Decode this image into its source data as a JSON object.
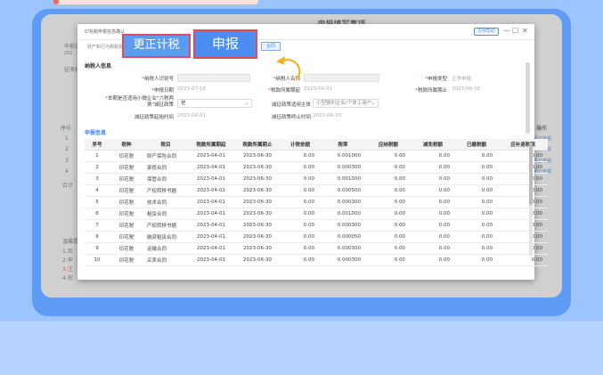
{
  "background": {
    "page_title": "申报填写事项",
    "side_labels": [
      "申报日",
      "202",
      "征收标",
      "序号",
      "1",
      "2",
      "3",
      "4",
      "合计",
      "温馨提",
      "1.到",
      "2.申",
      "3.注",
      "4.创"
    ],
    "ops_header": "操作",
    "ops_links": [
      "更正申报",
      "更正申报",
      "更正申报",
      "更正申报"
    ]
  },
  "dialog": {
    "title": "印花税申报信息确认",
    "subtitle": "财产和行为税税源",
    "help_label": "在线帮助",
    "controls": [
      "—",
      "☐",
      "✕"
    ],
    "ht_button": "合同",
    "taxpayer_section": "纳税人信息",
    "fields": {
      "taxpayer_id_label": "纳税人识别号",
      "taxpayer_name_label": "纳税人名称",
      "declare_type_label": "申报类型",
      "declare_type_value": "正常申报",
      "declare_date_label": "申报日期",
      "declare_date_value": "2023-07-18",
      "period_start_label": "税款所属期起",
      "period_start_value": "2023-04-01",
      "period_end_label": "税款所属期止",
      "period_end_value": "2023-06-30",
      "policy_label_1": "本期是否适用小微企业\"六税两",
      "policy_label_2": "费\"减征政策",
      "policy_value": "是",
      "subject_label": "减征政策适用主体",
      "subject_value": "小型微利企业/个体工商户",
      "reduce_start_label": "减征政策起始时间",
      "reduce_start_value": "2023-04-01",
      "reduce_end_label": "减征政策终止时间",
      "reduce_end_value": "2023-06-30"
    },
    "table_section": "申报信息",
    "columns": [
      "序号",
      "税种",
      "税目",
      "税款所属期起",
      "税款所属期止",
      "计税依据",
      "税率",
      "应纳税额",
      "减免税额",
      "已缴税额",
      "应补退税额"
    ],
    "rows": [
      [
        "1",
        "印花税",
        "财产保险合同",
        "2023-04-01",
        "2023-06-30",
        "0.00",
        "0.001000",
        "0.00",
        "0.00",
        "0.00",
        "0.00"
      ],
      [
        "2",
        "印花税",
        "承揽合同",
        "2023-04-01",
        "2023-06-30",
        "0.00",
        "0.000300",
        "0.00",
        "0.00",
        "0.00",
        "0.00"
      ],
      [
        "3",
        "印花税",
        "保管合同",
        "2023-04-01",
        "2023-06-30",
        "0.00",
        "0.001000",
        "0.00",
        "0.00",
        "0.00",
        "0.00"
      ],
      [
        "4",
        "印花税",
        "产权转移书据",
        "2023-04-01",
        "2023-06-30",
        "0.00",
        "0.000500",
        "0.00",
        "0.00",
        "0.00",
        "0.00"
      ],
      [
        "5",
        "印花税",
        "技术合同",
        "2023-04-01",
        "2023-06-30",
        "0.00",
        "0.000300",
        "0.00",
        "0.00",
        "0.00",
        "0.00"
      ],
      [
        "6",
        "印花税",
        "租赁合同",
        "2023-04-01",
        "2023-06-30",
        "0.00",
        "0.001000",
        "0.00",
        "0.00",
        "0.00",
        "0.00"
      ],
      [
        "7",
        "印花税",
        "产权转移书据",
        "2023-04-01",
        "2023-06-30",
        "0.00",
        "0.000300",
        "0.00",
        "0.00",
        "0.00",
        "0.00"
      ],
      [
        "8",
        "印花税",
        "融资租赁合同",
        "2023-04-01",
        "2023-06-30",
        "0.00",
        "0.000050",
        "0.00",
        "0.00",
        "0.00",
        "0.00"
      ],
      [
        "9",
        "印花税",
        "运输合同",
        "2023-04-01",
        "2023-06-30",
        "0.00",
        "0.000300",
        "0.00",
        "0.00",
        "0.00",
        "0.00"
      ],
      [
        "10",
        "印花税",
        "买卖合同",
        "2023-04-01",
        "2023-06-30",
        "0.00",
        "0.000300",
        "0.00",
        "0.00",
        "0.00",
        "0.00"
      ]
    ]
  },
  "callouts": {
    "correct_tax": "更正计税",
    "declare": "申报"
  },
  "colors": {
    "accent": "#4b8df0",
    "callout_border": "#e84a55",
    "card": "#5f9cf6",
    "arrow": "#f0b429"
  }
}
